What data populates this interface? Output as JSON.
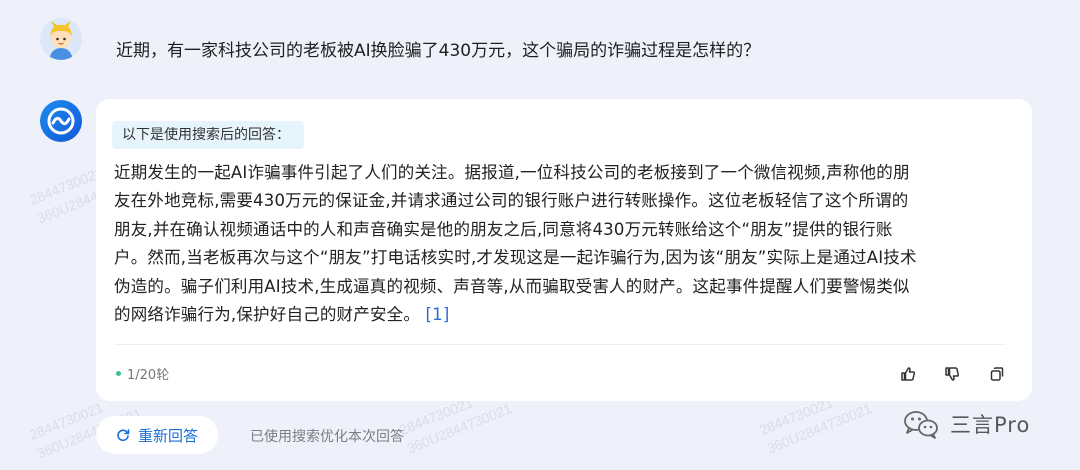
{
  "question": {
    "text": "近期，有一家科技公司的老板被AI换脸骗了430万元，这个骗局的诈骗过程是怎样的？"
  },
  "answer": {
    "search_tag": "以下是使用搜索后的回答：",
    "lines": [
      "近期发生的一起AI诈骗事件引起了人们的关注。据报道,一位科技公司的老板接到了一个微信视频,声称他的朋",
      "友在外地竞标,需要430万元的保证金,并请求通过公司的银行账户进行转账操作。这位老板轻信了这个所谓的",
      "朋友,并在确认视频通话中的人和声音确实是他的朋友之后,同意将430万元转账给这个“朋友”提供的银行账",
      "户。然而,当老板再次与这个“朋友”打电话核实时,才发现这是一起诈骗行为,因为该“朋友”实际上是通过AI技术",
      "伪造的。骗子们利用AI技术,生成逼真的视频、声音等,从而骗取受害人的财产。这起事件提醒人们要警惕类似",
      "的网络诈骗行为,保护好自己的财产安全。"
    ],
    "citation": "[1]",
    "round_counter": "1/20轮"
  },
  "actions": {
    "like_icon": "thumbs-up-icon",
    "dislike_icon": "thumbs-down-icon",
    "copy_icon": "copy-icon"
  },
  "footer": {
    "regenerate_label": "重新回答",
    "optimized_note": "已使用搜索优化本次回答",
    "brand_name": "三言Pro"
  },
  "watermarks": [
    "2844730021",
    "360U2844730021"
  ],
  "colors": {
    "accent": "#1a6ed8",
    "citation": "#2b6bd9",
    "search_tag_bg": "#e6f4fb",
    "page_bg": "#eef1f9"
  }
}
